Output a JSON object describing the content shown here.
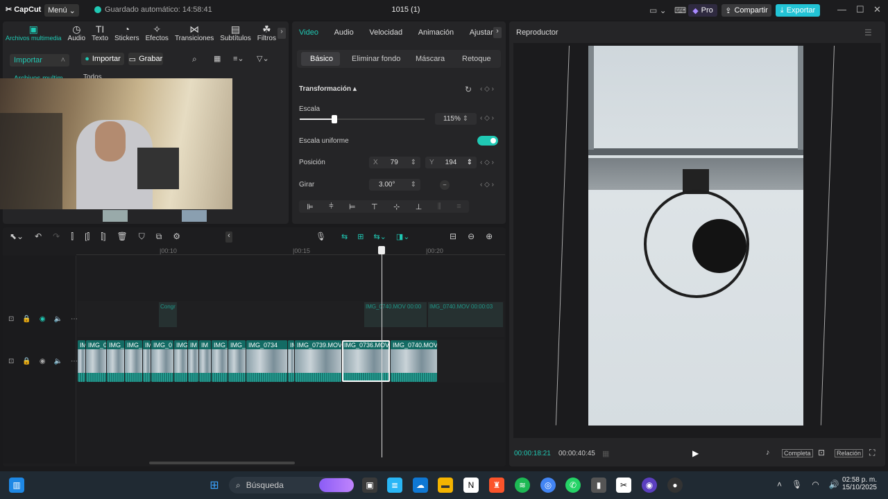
{
  "app": {
    "logo": "CapCut",
    "menu": "Menú",
    "autosave": "Guardado automático: 14:58:41",
    "project": "1015 (1)",
    "pro": "Pro",
    "share": "Compartir",
    "export": "Exportar"
  },
  "media_tabs": [
    {
      "label": "Archivos multimedia",
      "icon": "media-icon"
    },
    {
      "label": "Audio",
      "icon": "audio-icon"
    },
    {
      "label": "Texto",
      "icon": "text-icon"
    },
    {
      "label": "Stickers",
      "icon": "sticker-icon"
    },
    {
      "label": "Efectos",
      "icon": "effects-icon"
    },
    {
      "label": "Transiciones",
      "icon": "transition-icon"
    },
    {
      "label": "Subtítulos",
      "icon": "subtitle-icon"
    },
    {
      "label": "Filtros",
      "icon": "filter-icon"
    }
  ],
  "media": {
    "side_import": "Importar",
    "side_item": "Archivos multim...",
    "import_btn": "Importar",
    "record_btn": "Grabar",
    "all": "Todos"
  },
  "props": {
    "tabs": [
      "Video",
      "Audio",
      "Velocidad",
      "Animación",
      "Ajustar"
    ],
    "subtabs": [
      "Básico",
      "Eliminar fondo",
      "Máscara",
      "Retoque"
    ],
    "section": "Transformación",
    "scale_label": "Escala",
    "scale_value": "115%",
    "scale_fraction": 0.28,
    "uniform_label": "Escala uniforme",
    "uniform_on": true,
    "position_label": "Posición",
    "x_label": "X",
    "x_value": "79",
    "y_label": "Y",
    "y_value": "194",
    "rotate_label": "Girar",
    "rotate_value": "3.00°"
  },
  "player": {
    "title": "Reproductor",
    "current": "00:00:18:21",
    "total": "00:00:40:45",
    "full": "Completa",
    "ratio": "Relación"
  },
  "timeline": {
    "ticks": [
      "|00:10",
      "|00:15",
      "|00:20"
    ],
    "upper_clips": [
      "Congr",
      "IMG_0740.MOV  00:00",
      "IMG_0740.MOV  00:00:03"
    ],
    "clips": [
      "IMG_07",
      "IMG_07",
      "IMG_",
      "IMG_",
      "IM",
      "IMG_0",
      "IMG_",
      "IM",
      "IM",
      "IMG_C",
      "IMG_",
      "IMG_0734",
      "IM",
      "IMG_0739.MOV",
      "IMG_0736.MOV",
      "IMG_0740.MOV"
    ]
  },
  "taskbar": {
    "search": "Búsqueda",
    "time": "02:58 p. m.",
    "date": "15/10/2025"
  },
  "colors": {
    "accent": "#20c9b4",
    "export": "#22c4d6",
    "clip": "#1e8f86"
  }
}
